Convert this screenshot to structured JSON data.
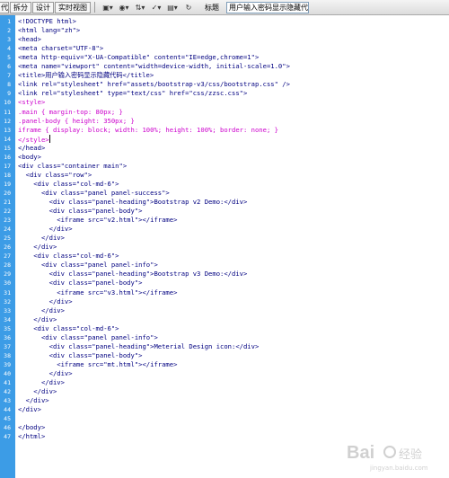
{
  "toolbar": {
    "code_view": "代码",
    "split_view": "拆分",
    "design_view": "设计",
    "live_view": "实时视图",
    "title_label": "标题",
    "title_value": "用户输入密码显示隐藏代码",
    "icons": [
      "multiscreen-icon",
      "preview-browser-icon",
      "file-management-icon",
      "check-page-icon",
      "visual-aids-icon",
      "refresh-icon"
    ]
  },
  "editor": {
    "lines": [
      {
        "n": "1",
        "text": "<!DOCTYPE html>",
        "kind": "tag"
      },
      {
        "n": "2",
        "text": "<html lang=\"zh\">",
        "kind": "tag"
      },
      {
        "n": "3",
        "text": "<head>",
        "kind": "tag"
      },
      {
        "n": "4",
        "text": "<meta charset=\"UTF-8\">",
        "kind": "tag"
      },
      {
        "n": "5",
        "text": "<meta http-equiv=\"X-UA-Compatible\" content=\"IE=edge,chrome=1\">",
        "kind": "tag"
      },
      {
        "n": "6",
        "text": "<meta name=\"viewport\" content=\"width=device-width, initial-scale=1.0\">",
        "kind": "tag"
      },
      {
        "n": "7",
        "text": "<title>用户输入密码显示隐藏代码</title>",
        "kind": "title"
      },
      {
        "n": "8",
        "text": "<link rel=\"stylesheet\" href=\"assets/bootstrap-v3/css/bootstrap.css\" />",
        "kind": "tag"
      },
      {
        "n": "9",
        "text": "<link rel=\"stylesheet\" type=\"text/css\" href=\"css/zzsc.css\">",
        "kind": "tag"
      },
      {
        "n": "10",
        "text": "<style>",
        "kind": "css"
      },
      {
        "n": "11",
        "text": ".main { margin-top: 80px; }",
        "kind": "css"
      },
      {
        "n": "12",
        "text": ".panel-body { height: 350px; }",
        "kind": "css"
      },
      {
        "n": "13",
        "text": "iframe { display: block; width: 100%; height: 100%; border: none; }",
        "kind": "css"
      },
      {
        "n": "14",
        "text": "</style>",
        "kind": "css-caret"
      },
      {
        "n": "15",
        "text": "</head>",
        "kind": "tag"
      },
      {
        "n": "16",
        "text": "<body>",
        "kind": "tag"
      },
      {
        "n": "17",
        "text": "<div class=\"container main\">",
        "kind": "tag"
      },
      {
        "n": "18",
        "text": "  <div class=\"row\">",
        "kind": "tag"
      },
      {
        "n": "19",
        "text": "    <div class=\"col-md-6\">",
        "kind": "tag"
      },
      {
        "n": "20",
        "text": "      <div class=\"panel panel-success\">",
        "kind": "tag"
      },
      {
        "n": "21",
        "text": "        <div class=\"panel-heading\">Bootstrap v2 Demo:</div>",
        "kind": "tag"
      },
      {
        "n": "22",
        "text": "        <div class=\"panel-body\">",
        "kind": "tag"
      },
      {
        "n": "23",
        "text": "          <iframe src=\"v2.html\"></iframe>",
        "kind": "tag"
      },
      {
        "n": "24",
        "text": "        </div>",
        "kind": "tag"
      },
      {
        "n": "25",
        "text": "      </div>",
        "kind": "tag"
      },
      {
        "n": "26",
        "text": "    </div>",
        "kind": "tag"
      },
      {
        "n": "27",
        "text": "    <div class=\"col-md-6\">",
        "kind": "tag"
      },
      {
        "n": "28",
        "text": "      <div class=\"panel panel-info\">",
        "kind": "tag"
      },
      {
        "n": "29",
        "text": "        <div class=\"panel-heading\">Bootstrap v3 Demo:</div>",
        "kind": "tag"
      },
      {
        "n": "30",
        "text": "        <div class=\"panel-body\">",
        "kind": "tag"
      },
      {
        "n": "31",
        "text": "          <iframe src=\"v3.html\"></iframe>",
        "kind": "tag"
      },
      {
        "n": "32",
        "text": "        </div>",
        "kind": "tag"
      },
      {
        "n": "33",
        "text": "      </div>",
        "kind": "tag"
      },
      {
        "n": "34",
        "text": "    </div>",
        "kind": "tag"
      },
      {
        "n": "35",
        "text": "    <div class=\"col-md-6\">",
        "kind": "tag"
      },
      {
        "n": "36",
        "text": "      <div class=\"panel panel-info\">",
        "kind": "tag"
      },
      {
        "n": "37",
        "text": "        <div class=\"panel-heading\">Meterial Design icon:</div>",
        "kind": "tag"
      },
      {
        "n": "38",
        "text": "        <div class=\"panel-body\">",
        "kind": "tag"
      },
      {
        "n": "39",
        "text": "          <iframe src=\"mt.html\"></iframe>",
        "kind": "tag"
      },
      {
        "n": "40",
        "text": "        </div>",
        "kind": "tag"
      },
      {
        "n": "41",
        "text": "      </div>",
        "kind": "tag"
      },
      {
        "n": "42",
        "text": "    </div>",
        "kind": "tag"
      },
      {
        "n": "43",
        "text": "  </div>",
        "kind": "tag"
      },
      {
        "n": "44",
        "text": "</div>",
        "kind": "tag"
      },
      {
        "n": "45",
        "text": "",
        "kind": "tag"
      },
      {
        "n": "46",
        "text": "</body>",
        "kind": "tag"
      },
      {
        "n": "47",
        "text": "</html>",
        "kind": "tag"
      }
    ]
  },
  "colors": {
    "gutter": "#3c9ce6",
    "tag": "#000080",
    "css": "#cc00cc"
  },
  "watermark": {
    "brand": "Bai",
    "brand2": "经验",
    "sub": "jingyan.baidu.com"
  }
}
